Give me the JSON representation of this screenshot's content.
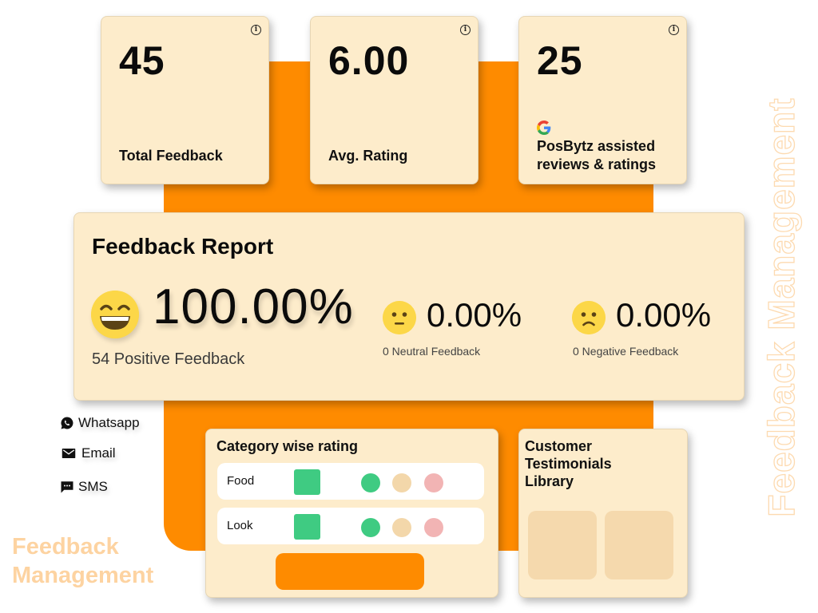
{
  "stats": [
    {
      "value": "45",
      "label": "Total Feedback",
      "icon": "info-icon"
    },
    {
      "value": "6.00",
      "label": "Avg. Rating",
      "icon": "info-icon"
    },
    {
      "value": "25",
      "label_line1": "PosBytz assisted",
      "label_line2": "reviews & ratings",
      "icon": "info-icon",
      "brand_icon": "google-icon"
    }
  ],
  "report": {
    "title": "Feedback Report",
    "positive": {
      "percent": "100.00%",
      "caption": "54 Positive Feedback",
      "icon": "grinning-face-icon"
    },
    "neutral": {
      "percent": "0.00%",
      "caption": "0 Neutral Feedback",
      "icon": "neutral-face-icon"
    },
    "negative": {
      "percent": "0.00%",
      "caption": "0 Negative Feedback",
      "icon": "frowning-face-icon"
    }
  },
  "channels": [
    {
      "label": "Whatsapp",
      "icon": "whatsapp-icon"
    },
    {
      "label": "Email",
      "icon": "email-icon"
    },
    {
      "label": "SMS",
      "icon": "sms-icon"
    }
  ],
  "category_rating": {
    "title": "Category wise rating",
    "rows": [
      {
        "name": "Food"
      },
      {
        "name": "Look"
      }
    ],
    "colors": {
      "square": "#3fcb82",
      "good": "#3fcb82",
      "neutral": "#f3d7aa",
      "bad": "#f2b4b4"
    }
  },
  "testimonials": {
    "title_line1": "Customer",
    "title_line2": "Testimonials",
    "title_line3": "Library"
  },
  "branding": {
    "line1": "Feedback",
    "line2": "Management",
    "vertical": "Feedback Management"
  },
  "colors": {
    "accent": "#fe8b00",
    "card_bg": "#fdeccb",
    "emoji": "#fcd748"
  }
}
